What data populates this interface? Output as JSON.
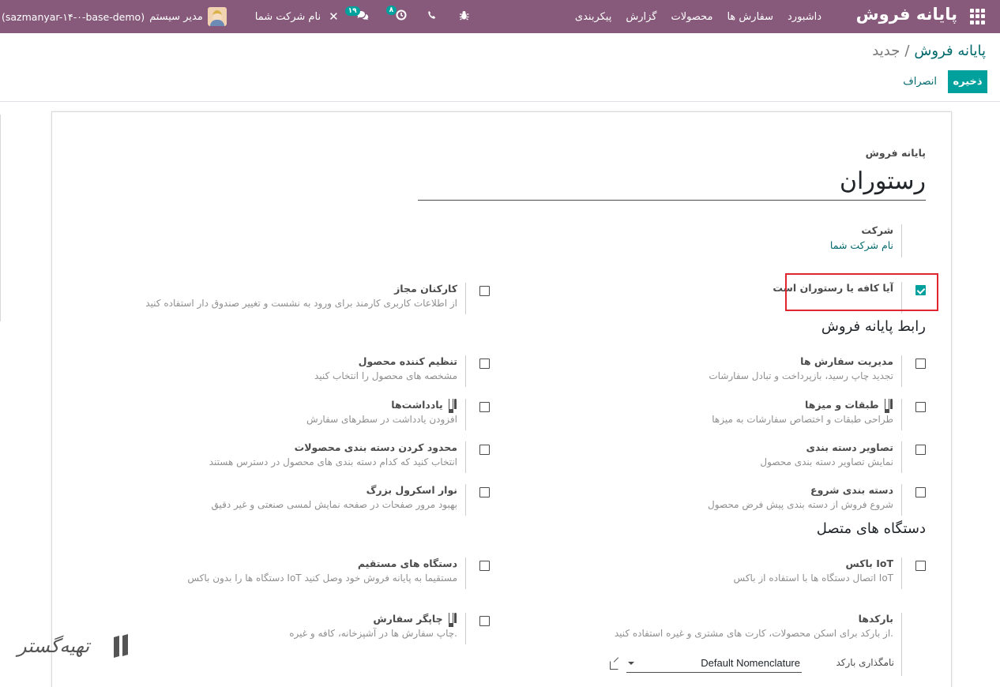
{
  "navbar": {
    "brand": "پایانه فروش",
    "menu": [
      "داشبورد",
      "سفارش ها",
      "محصولات",
      "گزارش",
      "پیکربندی"
    ],
    "db_name": "(sazmanyar-۱۴-۰-base-demo)",
    "user_name": "مدیر سیستم",
    "company_name": "نام شرکت شما",
    "activity_count": "۸",
    "messages_count": "۱۹",
    "icons": [
      "apps-icon",
      "bug-icon",
      "phone-icon",
      "clock-icon",
      "chat-icon",
      "close-icon"
    ],
    "colors": {
      "navbar_bg": "#875a7b",
      "badge_bg": "#00a09d"
    }
  },
  "breadcrumb": {
    "parent": "پایانه فروش",
    "separator": "/",
    "current": "جدید"
  },
  "buttons": {
    "save": "ذخیره",
    "discard": "انصراف"
  },
  "form": {
    "title_label": "پایانه فروش",
    "title_value": "رستوران",
    "company_label": "شرکت",
    "company_value": "نام شرکت شما"
  },
  "settings": {
    "is_restaurant": {
      "title": "آیا کافه یا رستوران است",
      "checked": true
    },
    "authorized_employees": {
      "title": "کارکنان مجاز",
      "desc": "از اطلاعات کاربری کارمند برای ورود به نشست و تغییر صندوق دار استفاده کنید",
      "checked": false
    }
  },
  "sections": {
    "pos_interface": "رابط پایانه فروش",
    "connected_devices": "دستگاه های متصل"
  },
  "interface_settings": [
    {
      "key": "order_management",
      "title": "مدیریت سفارش ها",
      "desc": "تجدید چاپ رسید، بازپرداخت و تبادل سفارشات",
      "checked": false,
      "fork": false
    },
    {
      "key": "product_configurator",
      "title": "تنظیم کننده محصول",
      "desc": "مشخصه های محصول را انتخاب کنید",
      "checked": false,
      "fork": false
    },
    {
      "key": "floors_tables",
      "title": "طبقات و میزها",
      "desc": "طراحی طبقات و اختصاص سفارشات به میزها",
      "checked": false,
      "fork": true
    },
    {
      "key": "notes",
      "title": "یادداشت‌ها",
      "desc": "افزودن یادداشت در سطرهای سفارش",
      "checked": false,
      "fork": true
    },
    {
      "key": "category_images",
      "title": "تصاویر دسته بندی",
      "desc": "نمایش تصاویر دسته بندی محصول",
      "checked": false,
      "fork": false
    },
    {
      "key": "limit_categories",
      "title": "محدود کردن دسته بندی محصولات",
      "desc": "انتخاب کنید که کدام دسته بندی های محصول در دسترس هستند",
      "checked": false,
      "fork": false
    },
    {
      "key": "start_category",
      "title": "دسته بندی شروع",
      "desc": "شروع فروش از دسته بندی پیش فرض محصول",
      "checked": false,
      "fork": false
    },
    {
      "key": "large_scrollbar",
      "title": "نوار اسکرول بزرگ",
      "desc": "بهبود مرور صفحات در صفحه نمایش لمسی صنعتی و غیر دقیق",
      "checked": false,
      "fork": false
    }
  ],
  "device_settings": [
    {
      "key": "iot_box",
      "title": "باکس IoT",
      "desc": "اتصال دستگاه ها با استفاده از باکس IoT",
      "checked": false,
      "fork": false
    },
    {
      "key": "direct_devices",
      "title": "دستگاه های مستقیم",
      "desc": "دستگاه ها را بدون باکس IoT مستقیما به پایانه فروش خود وصل کنید",
      "checked": false,
      "fork": false
    },
    {
      "key": "order_printer",
      "title": "چاپگر سفارش",
      "desc": "چاپ سفارش ها در آشپزخانه، کافه و غیره.",
      "checked": false,
      "fork": true
    }
  ],
  "barcodes": {
    "title": "بارکدها",
    "desc": "از بارکد برای اسکن محصولات، کارت های مشتری و غیره استفاده کنید.",
    "nomenclature_label": "نامگذاری بارکد",
    "nomenclature_value": "Default Nomenclature"
  },
  "watermark": {
    "text": "تهیه‌گستر"
  }
}
